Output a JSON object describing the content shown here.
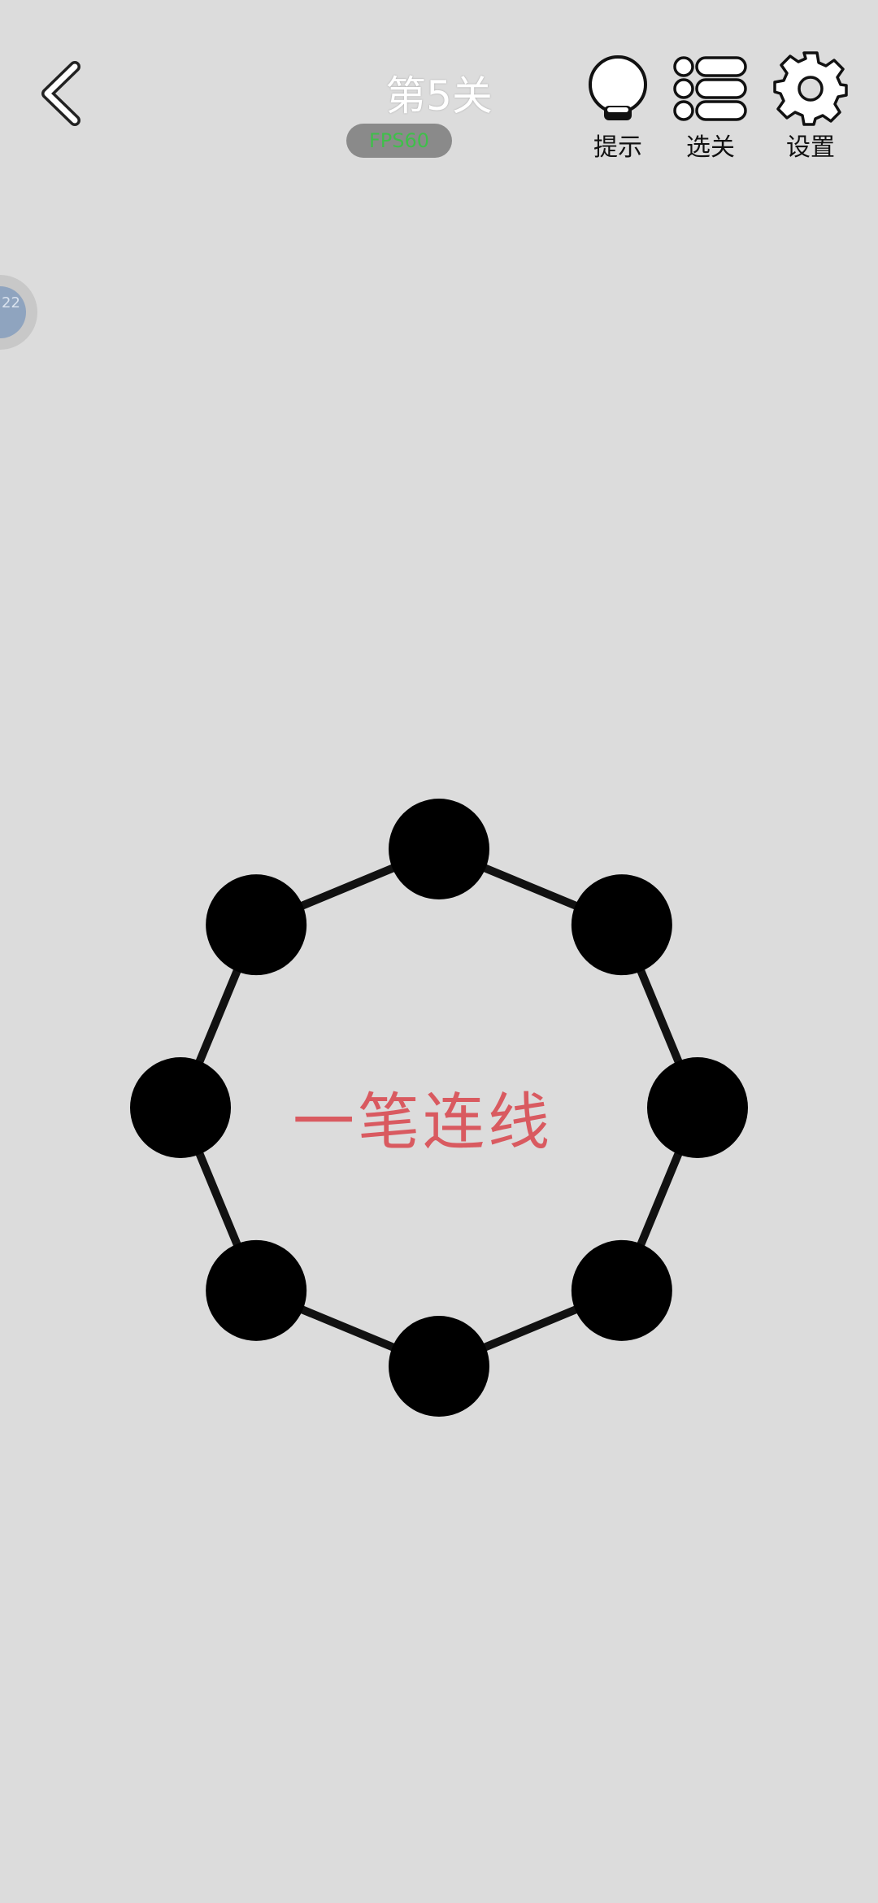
{
  "header": {
    "level_title": "第5关",
    "fps_badge": "FPS60",
    "tools": [
      {
        "label": "提示",
        "icon": "lightbulb-icon"
      },
      {
        "label": "选关",
        "icon": "level-list-icon"
      },
      {
        "label": "设置",
        "icon": "gear-icon"
      }
    ],
    "back_icon": "chevron-left-icon"
  },
  "floating_ball": {
    "text": "22",
    "icon": "floating-assistant-ball"
  },
  "puzzle": {
    "title": "一笔连线",
    "title_color": "#d95a60",
    "node_count": 8,
    "node_color": "#000000",
    "edge_color": "#111111",
    "edges": [
      [
        0,
        1
      ],
      [
        1,
        2
      ],
      [
        2,
        3
      ],
      [
        3,
        4
      ],
      [
        4,
        5
      ],
      [
        5,
        6
      ],
      [
        6,
        7
      ],
      [
        7,
        0
      ]
    ]
  }
}
